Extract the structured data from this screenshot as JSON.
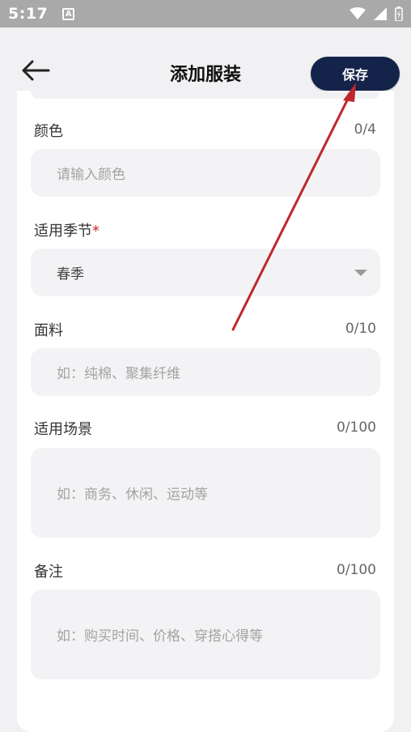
{
  "status_bar": {
    "time": "5:17",
    "notification_icon_letter": "A"
  },
  "header": {
    "title": "添加服装",
    "save_label": "保存",
    "back_icon": "arrow-left-icon",
    "save_button_color": "#13234a"
  },
  "form": {
    "color": {
      "label": "颜色",
      "counter": "0/4",
      "placeholder": "请输入颜色"
    },
    "season": {
      "label": "适用季节",
      "required_mark": "*",
      "value": "春季"
    },
    "fabric": {
      "label": "面料",
      "counter": "0/10",
      "placeholder": "如：纯棉、聚集纤维"
    },
    "scene": {
      "label": "适用场景",
      "counter": "0/100",
      "placeholder": "如：商务、休闲、运动等"
    },
    "notes": {
      "label": "备注",
      "counter": "0/100",
      "placeholder": "如：购买时间、价格、穿搭心得等"
    }
  },
  "colors": {
    "accent": "#13234a",
    "required": "#c62828",
    "annotation_arrow": "#c0262c"
  }
}
